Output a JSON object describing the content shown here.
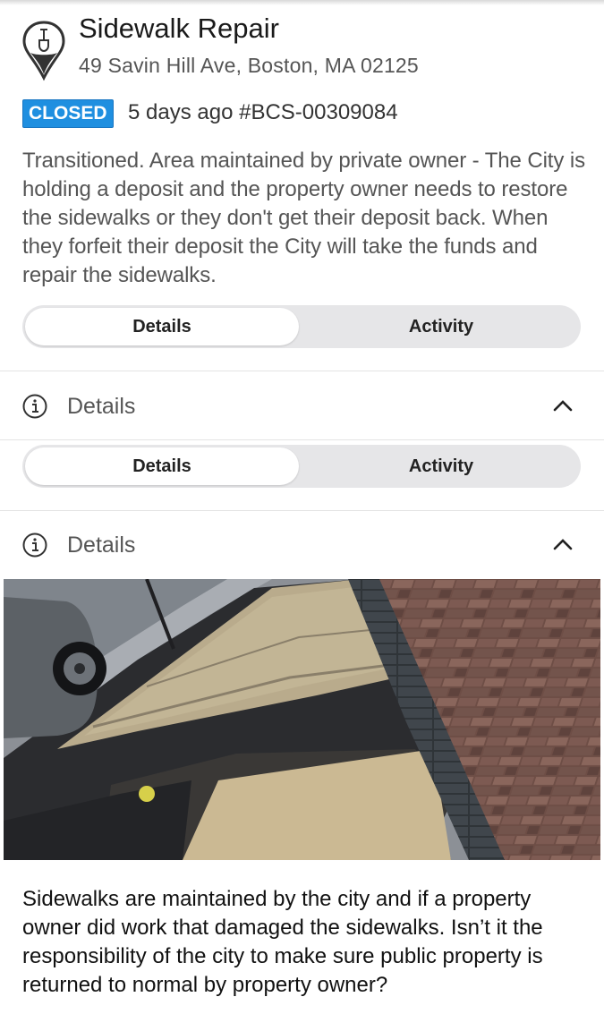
{
  "header": {
    "title": "Sidewalk Repair",
    "address": "49 Savin Hill Ave, Boston, MA 02125",
    "icon": "shovel-pin-icon"
  },
  "status": {
    "badge": "CLOSED",
    "badge_color": "#1f8fe0",
    "time_ago": "5 days ago",
    "case_id": "#BCS-00309084"
  },
  "description": "Transitioned. Area maintained by private owner - The City is holding a deposit and the property owner needs to restore the sidewalks or they don't get their deposit back.  When they forfeit their deposit the City will take the funds and repair the sidewalks.",
  "tabs_primary": {
    "details": "Details",
    "activity": "Activity",
    "selected": "Details"
  },
  "section_primary": {
    "title": "Details",
    "icon": "info-icon",
    "toggle": "chevron-up-icon"
  },
  "tabs_secondary": {
    "details": "Details",
    "activity": "Activity",
    "selected": "Details"
  },
  "section_secondary": {
    "title": "Details",
    "icon": "info-icon",
    "toggle": "chevron-up-icon"
  },
  "photo": {
    "subject": "sidewalk-photo"
  },
  "comment": "Sidewalks are maintained by the city and if a property owner did work that damaged the sidewalks.  Isn’t it the responsibility of the city to make sure public property is returned to normal by property owner?"
}
